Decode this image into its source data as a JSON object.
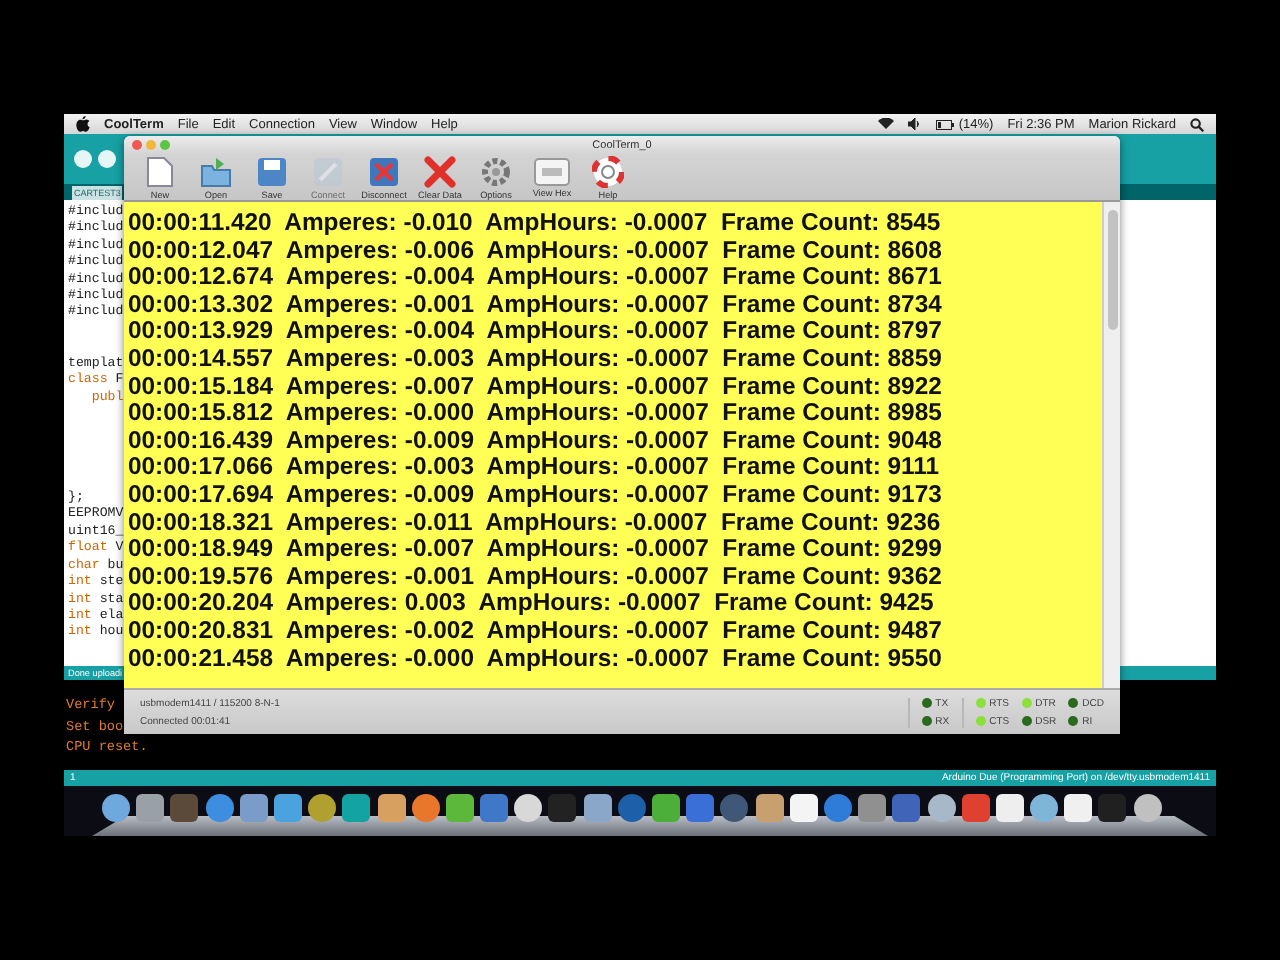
{
  "menu_bar": {
    "app": "CoolTerm",
    "items": [
      "File",
      "Edit",
      "Connection",
      "View",
      "Window",
      "Help"
    ],
    "battery": "(14%)",
    "clock": "Fri 2:36 PM",
    "user": "Marion Rickard"
  },
  "arduino": {
    "tab": "CARTEST3",
    "code": [
      [
        {
          "text": "#includ"
        },
        {
          "text": "#includ"
        },
        {
          "text": "#includ"
        },
        {
          "text": "#includ"
        },
        {
          "text": "#includ"
        },
        {
          "text": "#includ"
        },
        {
          "text": "#includ"
        }
      ],
      [
        {
          "text": "templat"
        },
        {
          "keyword": "class",
          "text": " F"
        },
        {
          "keyword": "   publ"
        }
      ],
      [
        {
          "text": "};"
        },
        {
          "text": "EEPROMV"
        },
        {
          "text": "uint16_"
        },
        {
          "keyword": "float",
          "text": " V"
        },
        {
          "keyword": "char",
          "text": " bu"
        },
        {
          "keyword": "int",
          "text": " ste"
        },
        {
          "keyword": "int",
          "text": " sta"
        },
        {
          "keyword": "int",
          "text": " ela"
        },
        {
          "keyword": "int",
          "text": " hou"
        }
      ]
    ],
    "notice": "Done uploadi",
    "console": [
      "Verify",
      "Set boo",
      "CPU reset."
    ],
    "line_number": "1",
    "board": "Arduino Due (Programming Port) on /dev/tty.usbmodem1411"
  },
  "coolterm": {
    "title": "CoolTerm_0",
    "toolbar": [
      {
        "label": "New",
        "disabled": false
      },
      {
        "label": "Open",
        "disabled": false
      },
      {
        "label": "Save",
        "disabled": false
      },
      {
        "label": "Connect",
        "disabled": true
      },
      {
        "label": "Disconnect",
        "disabled": false
      },
      {
        "label": "Clear Data",
        "disabled": false
      },
      {
        "label": "Options",
        "disabled": false
      },
      {
        "label": "View Hex",
        "disabled": false
      },
      {
        "label": "Help",
        "disabled": false
      }
    ],
    "lines": [
      "00:00:11.420  Amperes: -0.010  AmpHours: -0.0007  Frame Count: 8545",
      "00:00:12.047  Amperes: -0.006  AmpHours: -0.0007  Frame Count: 8608",
      "00:00:12.674  Amperes: -0.004  AmpHours: -0.0007  Frame Count: 8671",
      "00:00:13.302  Amperes: -0.001  AmpHours: -0.0007  Frame Count: 8734",
      "00:00:13.929  Amperes: -0.004  AmpHours: -0.0007  Frame Count: 8797",
      "00:00:14.557  Amperes: -0.003  AmpHours: -0.0007  Frame Count: 8859",
      "00:00:15.184  Amperes: -0.007  AmpHours: -0.0007  Frame Count: 8922",
      "00:00:15.812  Amperes: -0.000  AmpHours: -0.0007  Frame Count: 8985",
      "00:00:16.439  Amperes: -0.009  AmpHours: -0.0007  Frame Count: 9048",
      "00:00:17.066  Amperes: -0.003  AmpHours: -0.0007  Frame Count: 9111",
      "00:00:17.694  Amperes: -0.009  AmpHours: -0.0007  Frame Count: 9173",
      "00:00:18.321  Amperes: -0.011  AmpHours: -0.0007  Frame Count: 9236",
      "00:00:18.949  Amperes: -0.007  AmpHours: -0.0007  Frame Count: 9299",
      "00:00:19.576  Amperes: -0.001  AmpHours: -0.0007  Frame Count: 9362",
      "00:00:20.204  Amperes: 0.003  AmpHours: -0.0007  Frame Count: 9425",
      "00:00:20.831  Amperes: -0.002  AmpHours: -0.0007  Frame Count: 9487",
      "00:00:21.458  Amperes: -0.000  AmpHours: -0.0007  Frame Count: 9550"
    ],
    "port": "usbmodem1411 / 115200 8-N-1",
    "connection": "Connected 00:01:41",
    "signals": [
      {
        "label": "TX",
        "on": false
      },
      {
        "label": "RX",
        "on": false
      },
      {
        "label": "RTS",
        "on": true
      },
      {
        "label": "CTS",
        "on": true
      },
      {
        "label": "DTR",
        "on": true
      },
      {
        "label": "DSR",
        "on": false
      },
      {
        "label": "DCD",
        "on": false
      },
      {
        "label": "RI",
        "on": false
      }
    ]
  }
}
